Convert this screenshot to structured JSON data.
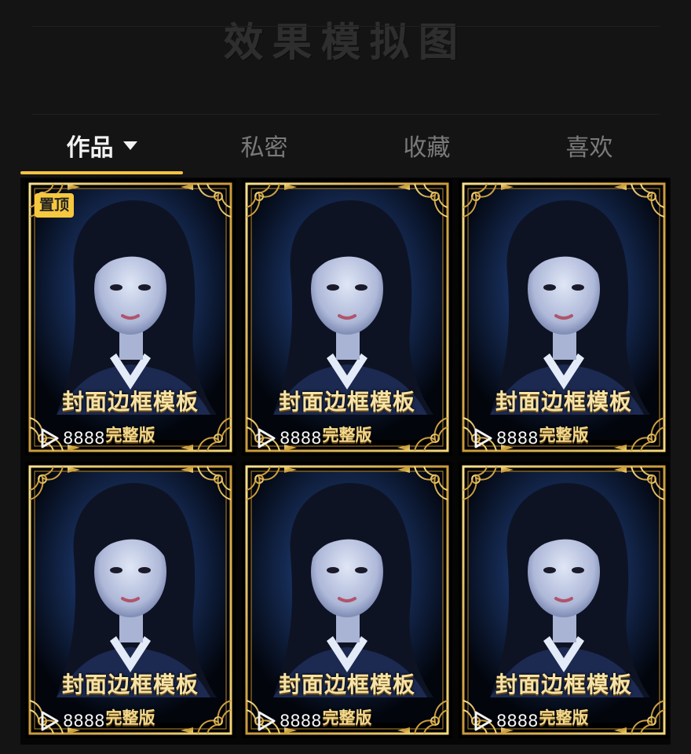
{
  "header": {
    "title": "效果模拟图"
  },
  "tabs": [
    {
      "label": "作品",
      "active": true
    },
    {
      "label": "私密",
      "active": false
    },
    {
      "label": "收藏",
      "active": false
    },
    {
      "label": "喜欢",
      "active": false
    }
  ],
  "accent_color": "#f5c242",
  "cards": [
    {
      "title": "封面边框模板",
      "subtitle": "完整版",
      "play_count": "8888",
      "pinned": true,
      "pin_label": "置顶"
    },
    {
      "title": "封面边框模板",
      "subtitle": "完整版",
      "play_count": "8888",
      "pinned": false
    },
    {
      "title": "封面边框模板",
      "subtitle": "完整版",
      "play_count": "8888",
      "pinned": false
    },
    {
      "title": "封面边框模板",
      "subtitle": "完整版",
      "play_count": "8888",
      "pinned": false
    },
    {
      "title": "封面边框模板",
      "subtitle": "完整版",
      "play_count": "8888",
      "pinned": false
    },
    {
      "title": "封面边框模板",
      "subtitle": "完整版",
      "play_count": "8888",
      "pinned": false
    }
  ]
}
